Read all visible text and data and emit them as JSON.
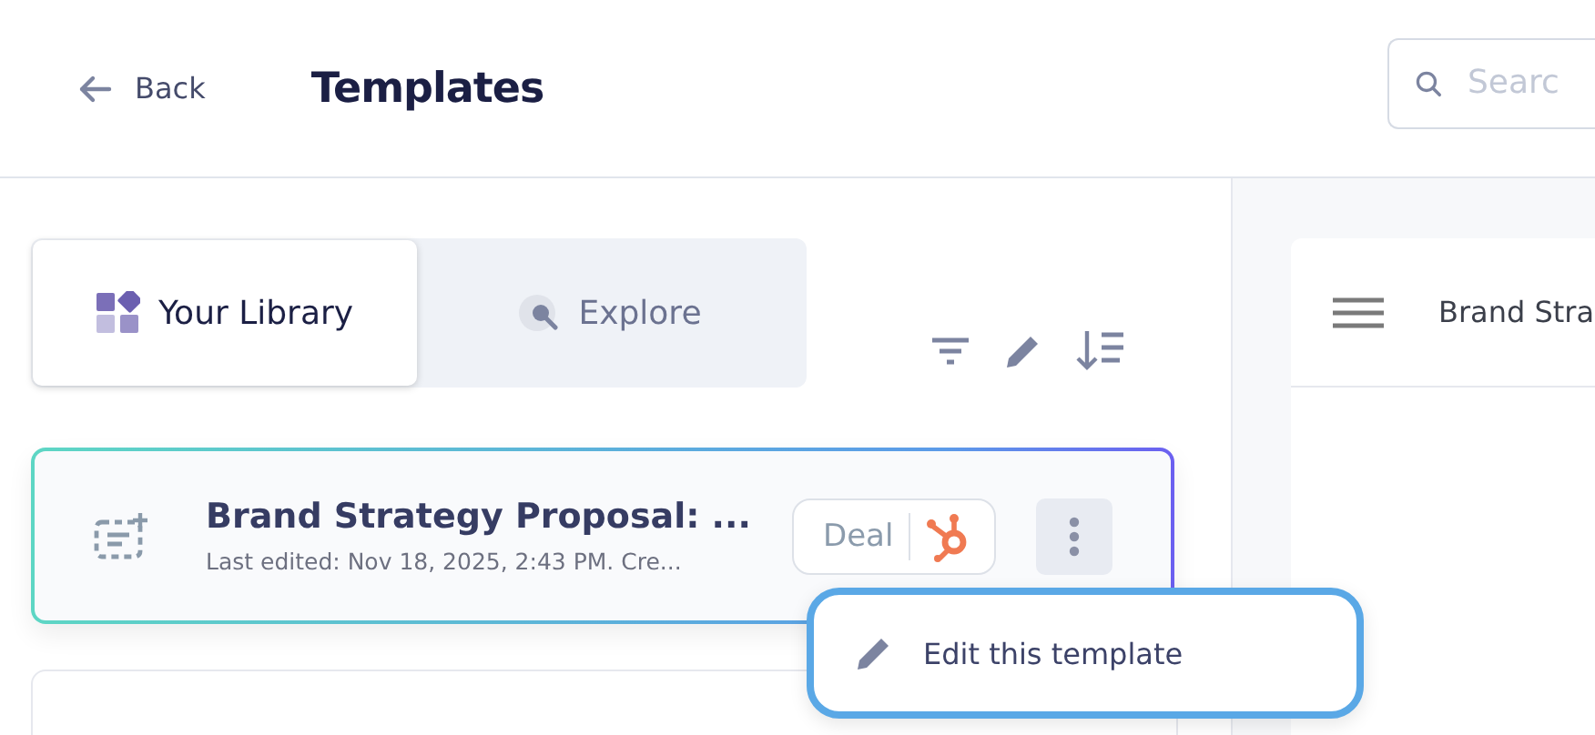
{
  "header": {
    "back": "Back",
    "title": "Templates",
    "search": {
      "placeholder": "Searc"
    }
  },
  "tabs": [
    {
      "label": "Your Library",
      "selected": true,
      "kind": "library"
    },
    {
      "label": "Explore",
      "selected": false,
      "kind": "explore"
    }
  ],
  "toolbar": [
    {
      "kind": "filter"
    },
    {
      "kind": "edit"
    },
    {
      "kind": "sort"
    }
  ],
  "templates": [
    {
      "title": "Brand Strategy Proposal: ...",
      "subtitle": "Last edited: Nov 18, 2025, 2:43 PM. Cre...",
      "tag": "Deal",
      "selected": true
    }
  ],
  "menu": {
    "items": [
      "Edit this template"
    ]
  },
  "preview": {
    "title": "Brand Stra"
  }
}
